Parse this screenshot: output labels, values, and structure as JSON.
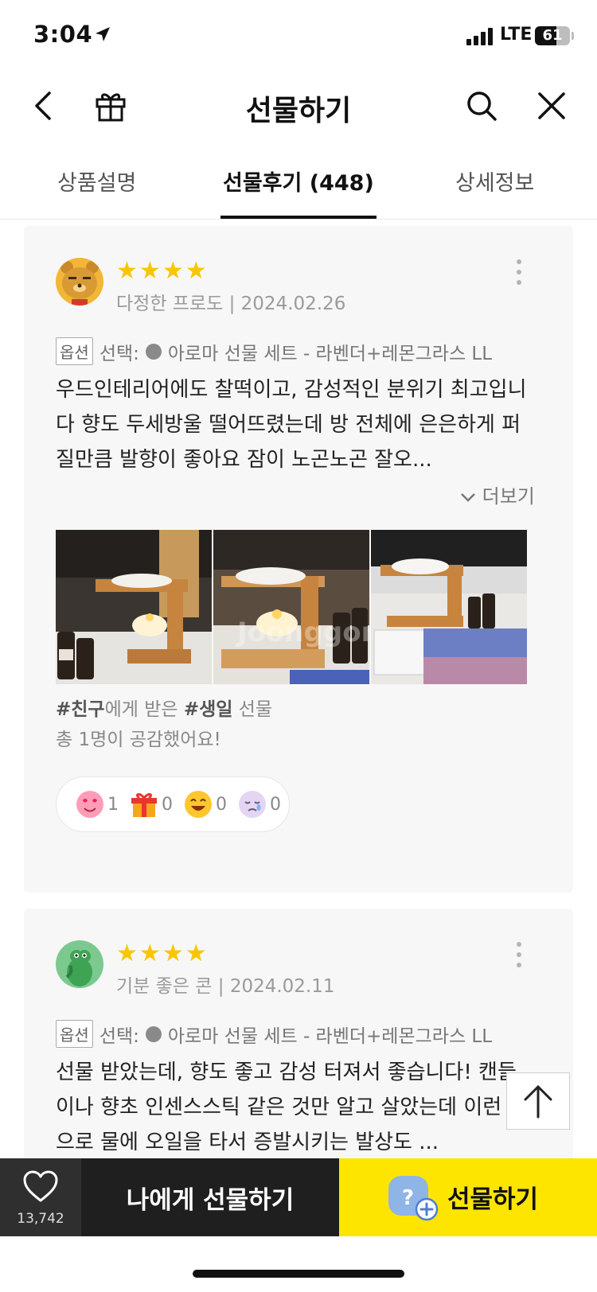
{
  "status_bar": {
    "time": "3:04",
    "network": "LTE",
    "battery": "61"
  },
  "header": {
    "title": "선물하기",
    "icons": [
      "back-icon",
      "gift-icon",
      "search-icon",
      "close-icon"
    ]
  },
  "tabs": [
    {
      "label": "상품설명"
    },
    {
      "label": "선물후기 (448)",
      "active": true
    },
    {
      "label": "상세정보"
    }
  ],
  "reviews": [
    {
      "rating": 4,
      "author": "다정한 프로도",
      "date": "2024.02.26",
      "option_badge": "옵션",
      "option_text": "선택:",
      "option_value": "아로마 선물 세트 - 라벤더+레몬그라스 LL",
      "text": "우드인테리어에도 찰떡이고, 감성적인 분위기 최고입니다 향도 두세방울 떨어뜨렸는데 방 전체에 은은하게 퍼질만큼 발향이 좋아요 잠이 노곤노곤 잘오...",
      "more_label": "더보기",
      "photo_watermark": "Joonggonara",
      "tag_friend": "#친구",
      "tag_mid": "에게 받은 ",
      "tag_occasion": "#생일",
      "tag_end": " 선물",
      "empathy": "총 1명이 공감했어요!",
      "reactions": [
        {
          "icon": "heart-eyes-emoji-icon",
          "count": "1"
        },
        {
          "icon": "gift-box-emoji-icon",
          "count": "0"
        },
        {
          "icon": "laughing-emoji-icon",
          "count": "0"
        },
        {
          "icon": "sad-emoji-icon",
          "count": "0"
        }
      ]
    },
    {
      "rating": 4,
      "author": "기분 좋은 콘",
      "date": "2024.02.11",
      "option_badge": "옵션",
      "option_text": "선택:",
      "option_value": "아로마 선물 세트 - 라벤더+레몬그라스 LL",
      "text": "선물 받았는데, 향도 좋고 감성 터져서 좋습니다! 캔들이나 향초 인센스스틱 같은 것만 알고 살았는데 이런 식으로 물에 오일을 타서 증발시키는 발상도 ..."
    }
  ],
  "bottom_bar": {
    "like_count": "13,742",
    "self_gift_label": "나에게 선물하기",
    "gift_label": "선물하기"
  },
  "colors": {
    "accent": "#fee500",
    "star": "#f8c600",
    "dark": "#1f1f1f"
  }
}
